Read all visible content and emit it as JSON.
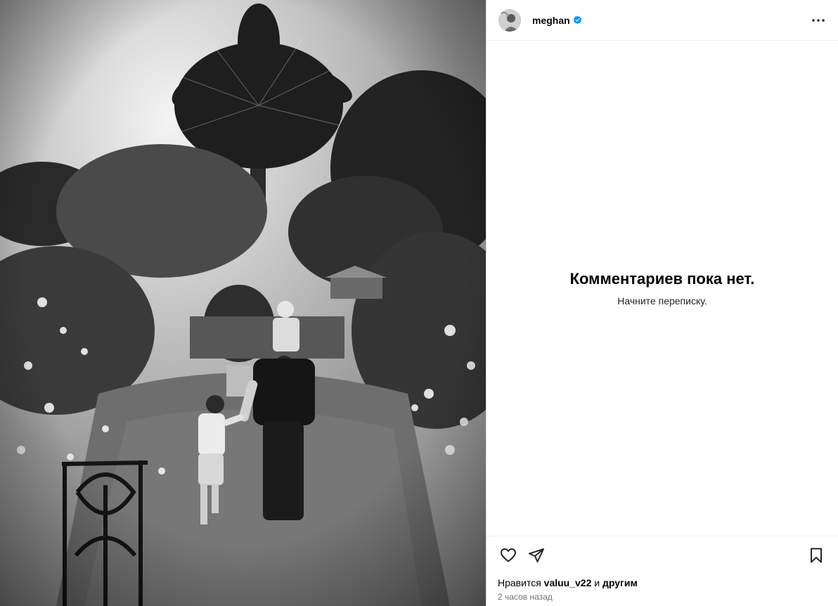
{
  "post": {
    "image_alt": "",
    "author": {
      "username": "meghan",
      "verified": true,
      "avatar_icon": "profile-photo"
    },
    "more_icon": "more-options-icon"
  },
  "comments": {
    "empty_title": "Комментариев пока нет.",
    "empty_subtitle": "Начните переписку."
  },
  "actions": {
    "like_icon": "heart-icon",
    "share_icon": "send-icon",
    "save_icon": "bookmark-icon"
  },
  "likes": {
    "prefix": "Нравится",
    "user": "valuu_v22",
    "joiner": "и",
    "others": "другим"
  },
  "timestamp": "2 часов назад",
  "colors": {
    "verified_blue": "#0095f6",
    "border": "#dbdbdb",
    "muted_text": "#737373"
  }
}
